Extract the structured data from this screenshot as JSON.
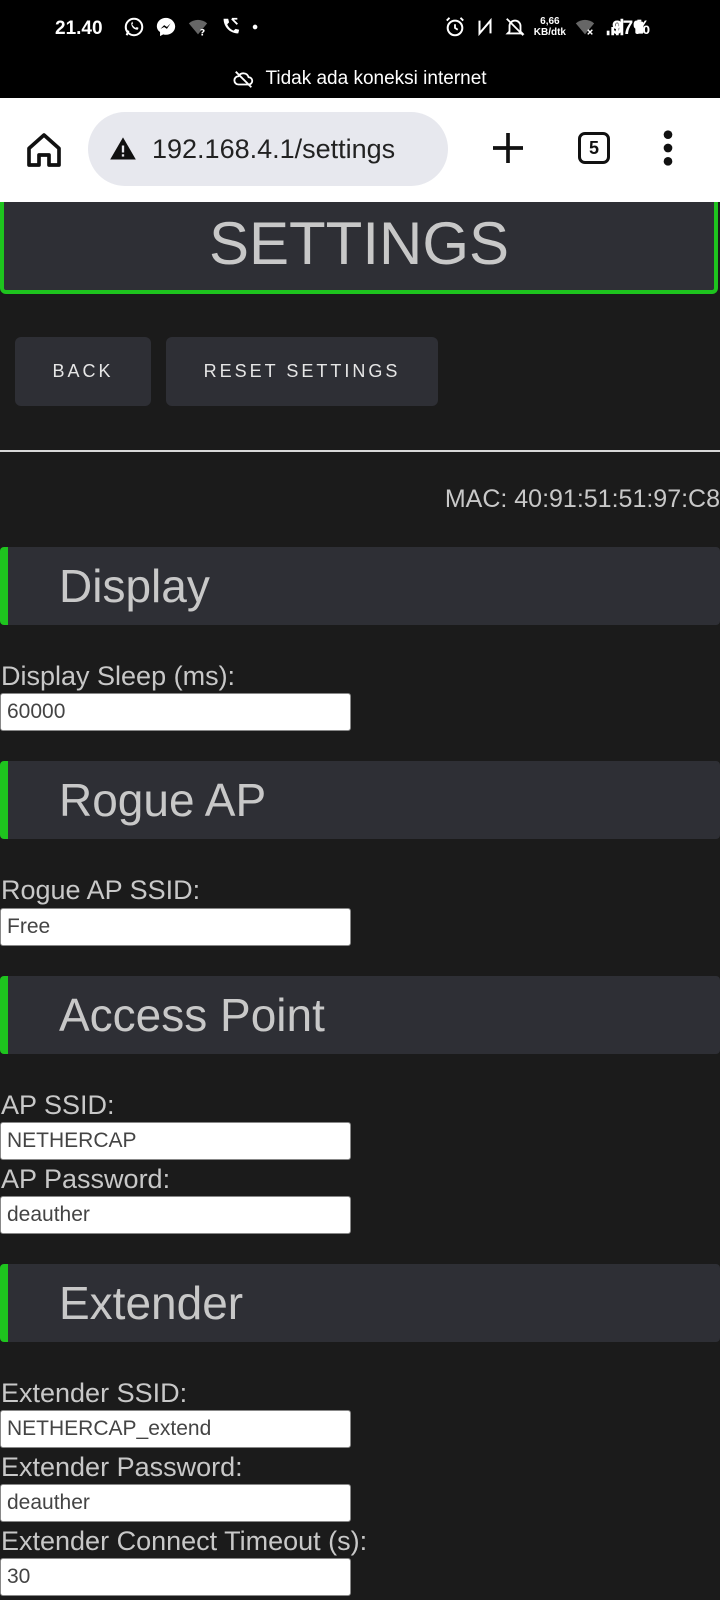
{
  "status_bar": {
    "time": "21.40",
    "speed_value": "6,66",
    "speed_unit": "KB/dtk",
    "battery": "97%"
  },
  "net_banner": {
    "text": "Tidak ada koneksi internet"
  },
  "browser": {
    "url": "192.168.4.1/settings",
    "tab_count": "5"
  },
  "page": {
    "title": "SETTINGS",
    "back_label": "BACK",
    "reset_label": "RESET SETTINGS",
    "mac": "MAC: 40:91:51:51:97:C8"
  },
  "sections": {
    "display": {
      "title": "Display",
      "sleep_label": "Display Sleep (ms):",
      "sleep_value": "60000"
    },
    "rogue_ap": {
      "title": "Rogue AP",
      "ssid_label": "Rogue AP SSID:",
      "ssid_value": "Free"
    },
    "access_point": {
      "title": "Access Point",
      "ssid_label": "AP SSID:",
      "ssid_value": "NETHERCAP",
      "password_label": "AP Password:",
      "password_value": "deauther"
    },
    "extender": {
      "title": "Extender",
      "ssid_label": "Extender SSID:",
      "ssid_value": "NETHERCAP_extend",
      "password_label": "Extender Password:",
      "password_value": "deauther",
      "timeout_label": "Extender Connect Timeout (s):",
      "timeout_value": "30"
    }
  },
  "colors": {
    "accent": "#1ec41e",
    "page_bg": "#1b1b1b",
    "panel_bg": "#2e2f35",
    "text": "#c8c8c8"
  }
}
